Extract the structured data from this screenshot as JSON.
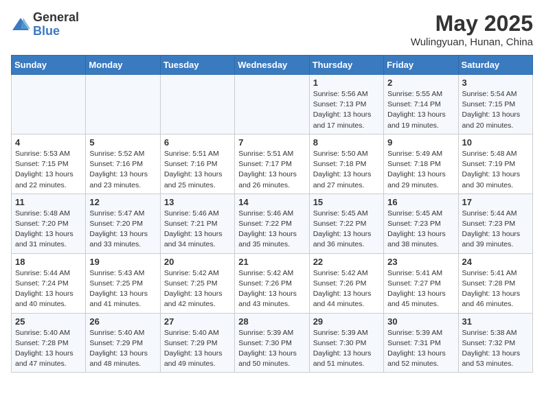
{
  "logo": {
    "general": "General",
    "blue": "Blue"
  },
  "title": "May 2025",
  "location": "Wulingyuan, Hunan, China",
  "days_of_week": [
    "Sunday",
    "Monday",
    "Tuesday",
    "Wednesday",
    "Thursday",
    "Friday",
    "Saturday"
  ],
  "weeks": [
    [
      {
        "day": "",
        "info": ""
      },
      {
        "day": "",
        "info": ""
      },
      {
        "day": "",
        "info": ""
      },
      {
        "day": "",
        "info": ""
      },
      {
        "day": "1",
        "info": "Sunrise: 5:56 AM\nSunset: 7:13 PM\nDaylight: 13 hours\nand 17 minutes."
      },
      {
        "day": "2",
        "info": "Sunrise: 5:55 AM\nSunset: 7:14 PM\nDaylight: 13 hours\nand 19 minutes."
      },
      {
        "day": "3",
        "info": "Sunrise: 5:54 AM\nSunset: 7:15 PM\nDaylight: 13 hours\nand 20 minutes."
      }
    ],
    [
      {
        "day": "4",
        "info": "Sunrise: 5:53 AM\nSunset: 7:15 PM\nDaylight: 13 hours\nand 22 minutes."
      },
      {
        "day": "5",
        "info": "Sunrise: 5:52 AM\nSunset: 7:16 PM\nDaylight: 13 hours\nand 23 minutes."
      },
      {
        "day": "6",
        "info": "Sunrise: 5:51 AM\nSunset: 7:16 PM\nDaylight: 13 hours\nand 25 minutes."
      },
      {
        "day": "7",
        "info": "Sunrise: 5:51 AM\nSunset: 7:17 PM\nDaylight: 13 hours\nand 26 minutes."
      },
      {
        "day": "8",
        "info": "Sunrise: 5:50 AM\nSunset: 7:18 PM\nDaylight: 13 hours\nand 27 minutes."
      },
      {
        "day": "9",
        "info": "Sunrise: 5:49 AM\nSunset: 7:18 PM\nDaylight: 13 hours\nand 29 minutes."
      },
      {
        "day": "10",
        "info": "Sunrise: 5:48 AM\nSunset: 7:19 PM\nDaylight: 13 hours\nand 30 minutes."
      }
    ],
    [
      {
        "day": "11",
        "info": "Sunrise: 5:48 AM\nSunset: 7:20 PM\nDaylight: 13 hours\nand 31 minutes."
      },
      {
        "day": "12",
        "info": "Sunrise: 5:47 AM\nSunset: 7:20 PM\nDaylight: 13 hours\nand 33 minutes."
      },
      {
        "day": "13",
        "info": "Sunrise: 5:46 AM\nSunset: 7:21 PM\nDaylight: 13 hours\nand 34 minutes."
      },
      {
        "day": "14",
        "info": "Sunrise: 5:46 AM\nSunset: 7:22 PM\nDaylight: 13 hours\nand 35 minutes."
      },
      {
        "day": "15",
        "info": "Sunrise: 5:45 AM\nSunset: 7:22 PM\nDaylight: 13 hours\nand 36 minutes."
      },
      {
        "day": "16",
        "info": "Sunrise: 5:45 AM\nSunset: 7:23 PM\nDaylight: 13 hours\nand 38 minutes."
      },
      {
        "day": "17",
        "info": "Sunrise: 5:44 AM\nSunset: 7:23 PM\nDaylight: 13 hours\nand 39 minutes."
      }
    ],
    [
      {
        "day": "18",
        "info": "Sunrise: 5:44 AM\nSunset: 7:24 PM\nDaylight: 13 hours\nand 40 minutes."
      },
      {
        "day": "19",
        "info": "Sunrise: 5:43 AM\nSunset: 7:25 PM\nDaylight: 13 hours\nand 41 minutes."
      },
      {
        "day": "20",
        "info": "Sunrise: 5:42 AM\nSunset: 7:25 PM\nDaylight: 13 hours\nand 42 minutes."
      },
      {
        "day": "21",
        "info": "Sunrise: 5:42 AM\nSunset: 7:26 PM\nDaylight: 13 hours\nand 43 minutes."
      },
      {
        "day": "22",
        "info": "Sunrise: 5:42 AM\nSunset: 7:26 PM\nDaylight: 13 hours\nand 44 minutes."
      },
      {
        "day": "23",
        "info": "Sunrise: 5:41 AM\nSunset: 7:27 PM\nDaylight: 13 hours\nand 45 minutes."
      },
      {
        "day": "24",
        "info": "Sunrise: 5:41 AM\nSunset: 7:28 PM\nDaylight: 13 hours\nand 46 minutes."
      }
    ],
    [
      {
        "day": "25",
        "info": "Sunrise: 5:40 AM\nSunset: 7:28 PM\nDaylight: 13 hours\nand 47 minutes."
      },
      {
        "day": "26",
        "info": "Sunrise: 5:40 AM\nSunset: 7:29 PM\nDaylight: 13 hours\nand 48 minutes."
      },
      {
        "day": "27",
        "info": "Sunrise: 5:40 AM\nSunset: 7:29 PM\nDaylight: 13 hours\nand 49 minutes."
      },
      {
        "day": "28",
        "info": "Sunrise: 5:39 AM\nSunset: 7:30 PM\nDaylight: 13 hours\nand 50 minutes."
      },
      {
        "day": "29",
        "info": "Sunrise: 5:39 AM\nSunset: 7:30 PM\nDaylight: 13 hours\nand 51 minutes."
      },
      {
        "day": "30",
        "info": "Sunrise: 5:39 AM\nSunset: 7:31 PM\nDaylight: 13 hours\nand 52 minutes."
      },
      {
        "day": "31",
        "info": "Sunrise: 5:38 AM\nSunset: 7:32 PM\nDaylight: 13 hours\nand 53 minutes."
      }
    ]
  ]
}
